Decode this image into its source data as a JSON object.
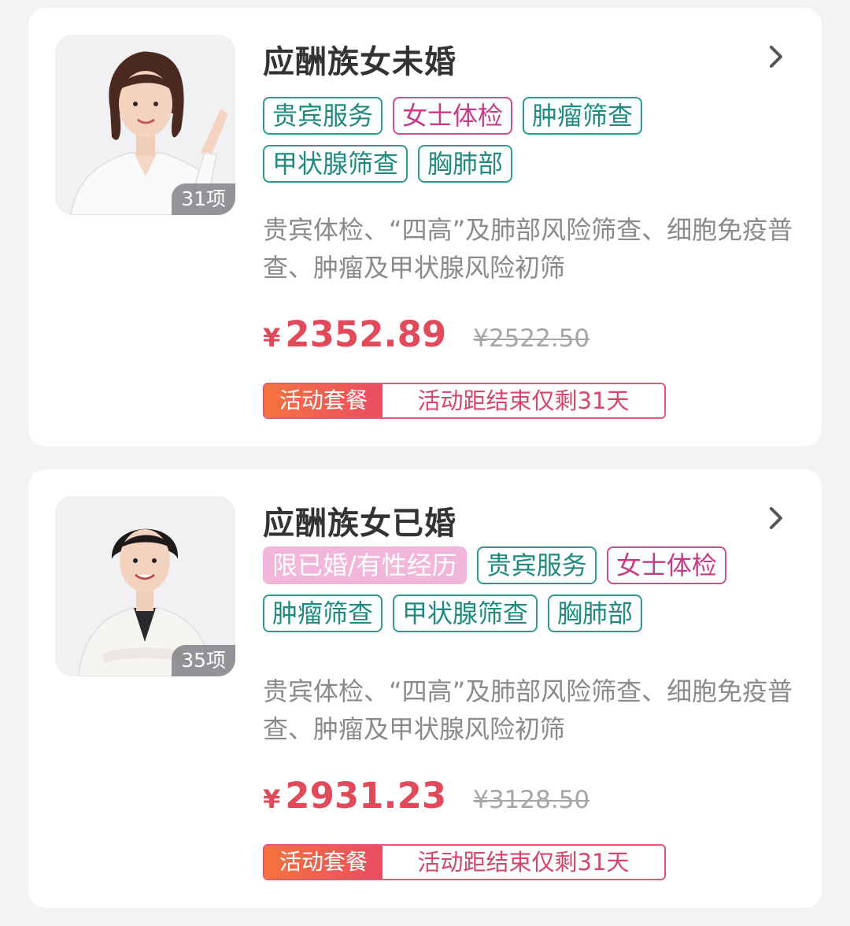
{
  "packages": [
    {
      "title": "应酬族女未婚",
      "item_count": "31项",
      "tags": [
        {
          "label": "贵宾服务",
          "style": "teal"
        },
        {
          "label": "女士体检",
          "style": "pink"
        },
        {
          "label": "肿瘤筛查",
          "style": "teal"
        },
        {
          "label": "甲状腺筛查",
          "style": "teal"
        },
        {
          "label": "胸肺部",
          "style": "teal"
        }
      ],
      "description": "贵宾体检、“四高”及肺部风险筛查、细胞免疫普查、肿瘤及甲状腺风险初筛",
      "currency": "¥",
      "price": "2352.89",
      "original_price": "¥2522.50",
      "promo_label": "活动套餐",
      "promo_text": "活动距结束仅剩31天"
    },
    {
      "title": "应酬族女已婚",
      "item_count": "35项",
      "tags": [
        {
          "label": "限已婚/有性经历",
          "style": "marital"
        },
        {
          "label": "贵宾服务",
          "style": "teal"
        },
        {
          "label": "女士体检",
          "style": "pink"
        },
        {
          "label": "肿瘤筛查",
          "style": "teal"
        },
        {
          "label": "甲状腺筛查",
          "style": "teal"
        },
        {
          "label": "胸肺部",
          "style": "teal"
        }
      ],
      "description": "贵宾体检、“四高”及肺部风险筛查、细胞免疫普查、肿瘤及甲状腺风险初筛",
      "currency": "¥",
      "price": "2931.23",
      "original_price": "¥3128.50",
      "promo_label": "活动套餐",
      "promo_text": "活动距结束仅剩31天"
    }
  ],
  "colors": {
    "teal_tag": "#2e9a90",
    "pink_tag": "#cf4b8e",
    "marital_tag_bg": "#f1b6da",
    "price": "#e04a5a",
    "promo_gradient_start": "#f5733f",
    "promo_gradient_end": "#ea4c62"
  },
  "icons": {
    "chevron": "chevron-right-icon"
  }
}
